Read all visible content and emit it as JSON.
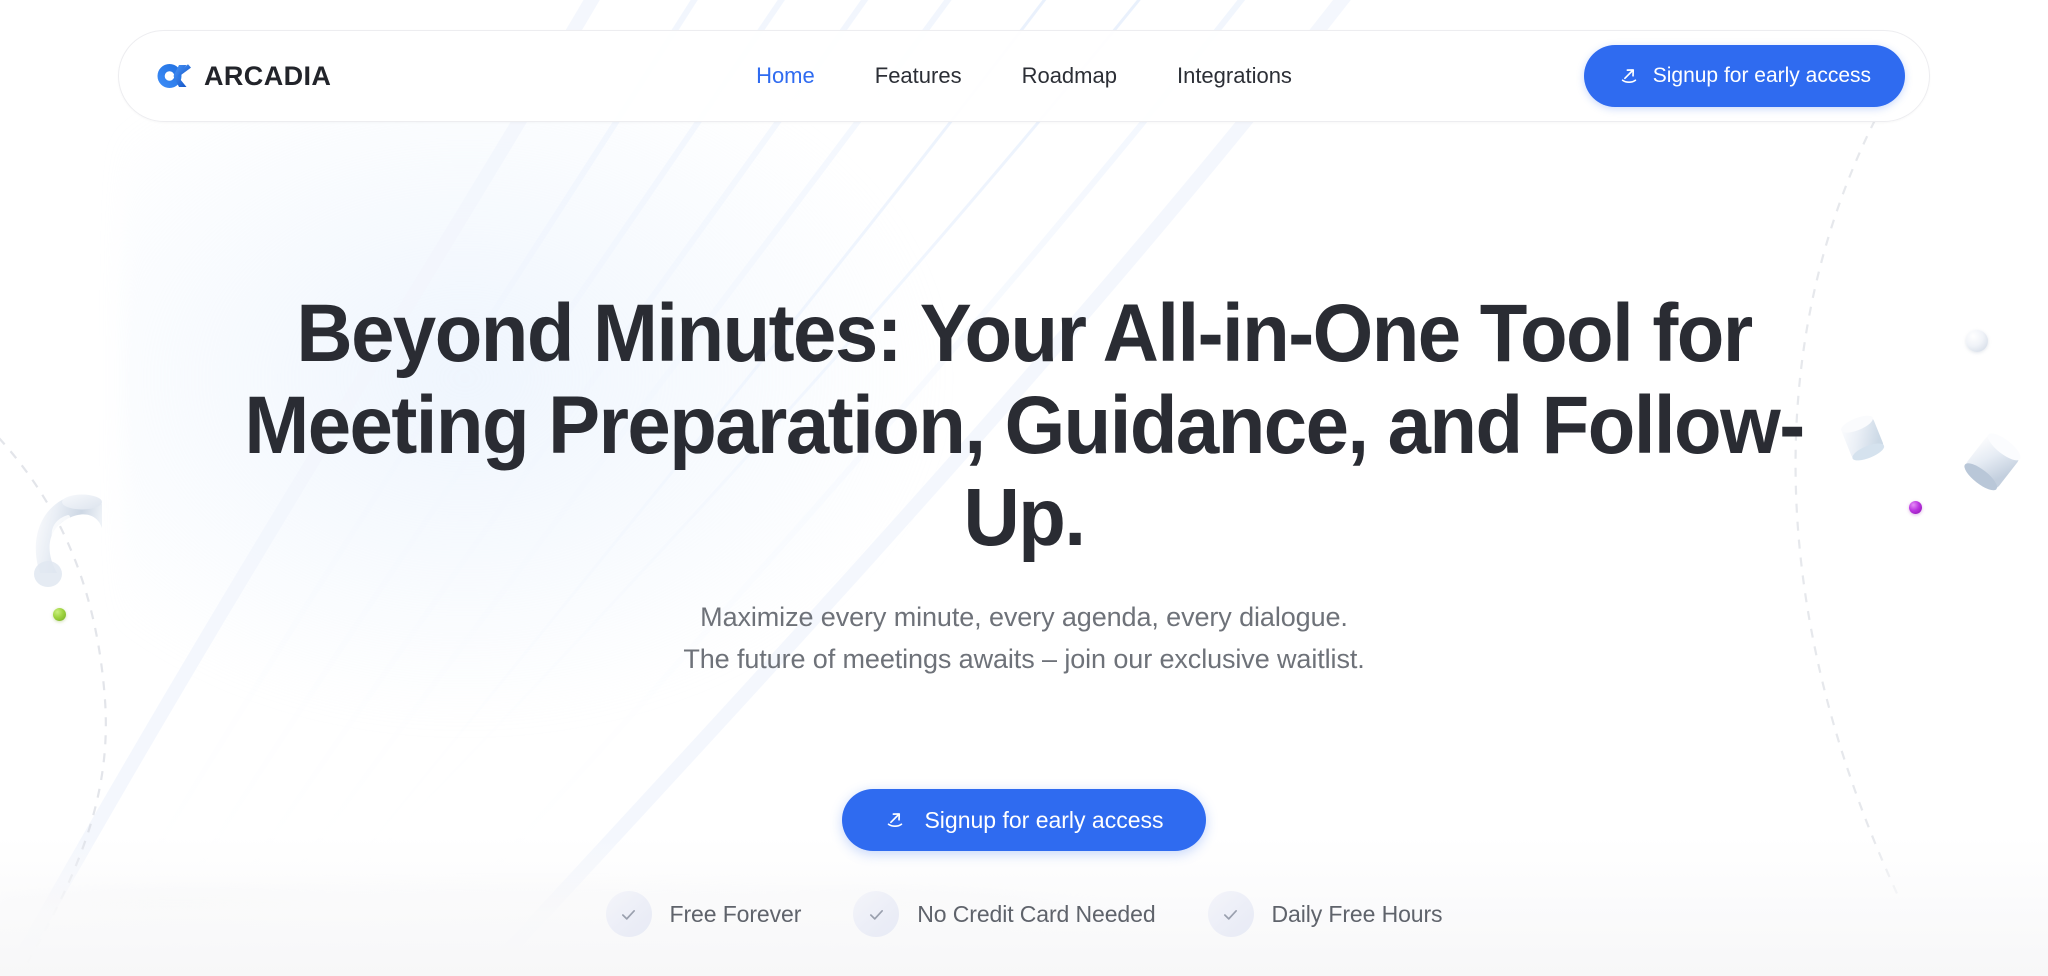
{
  "brand": {
    "name": "ARCADIA",
    "mark_icon": "arcadia-logo-icon",
    "mark_color": "#3b8cf5"
  },
  "header": {
    "nav": [
      {
        "label": "Home",
        "active": true
      },
      {
        "label": "Features",
        "active": false
      },
      {
        "label": "Roadmap",
        "active": false
      },
      {
        "label": "Integrations",
        "active": false
      }
    ],
    "cta": {
      "label": "Signup for early access",
      "icon": "arrow-up-right-launch-icon",
      "bg_color": "#2f6bf0",
      "text_color": "#ffffff"
    }
  },
  "hero": {
    "headline": "Beyond Minutes: Your All-in-One Tool for Meeting Preparation, Guidance, and Follow-Up.",
    "subtitle_line_1": "Maximize every minute, every agenda, every dialogue.",
    "subtitle_line_2": "The future of meetings awaits – join our exclusive waitlist.",
    "cta": {
      "label": "Signup for early access",
      "icon": "arrow-up-right-launch-icon",
      "bg_color": "#2f6bf0",
      "text_color": "#ffffff"
    },
    "perks": [
      {
        "label": "Free Forever",
        "icon": "check-icon"
      },
      {
        "label": "No Credit Card Needed",
        "icon": "check-icon"
      },
      {
        "label": "Daily Free Hours",
        "icon": "check-icon"
      }
    ]
  },
  "decorations": {
    "accent_dot_green": "#8fcb3a",
    "accent_dot_purple": "#b12ad6",
    "prop_fill": "#e4e9f1",
    "background_swirl_color": "#eef4fd"
  },
  "theme": {
    "page_background": "#ffffff",
    "heading_color": "#2a2c33",
    "body_text_color": "#6e7279",
    "accent_blue": "#2f6bf0",
    "nav_active_color": "#2f6bf0"
  }
}
